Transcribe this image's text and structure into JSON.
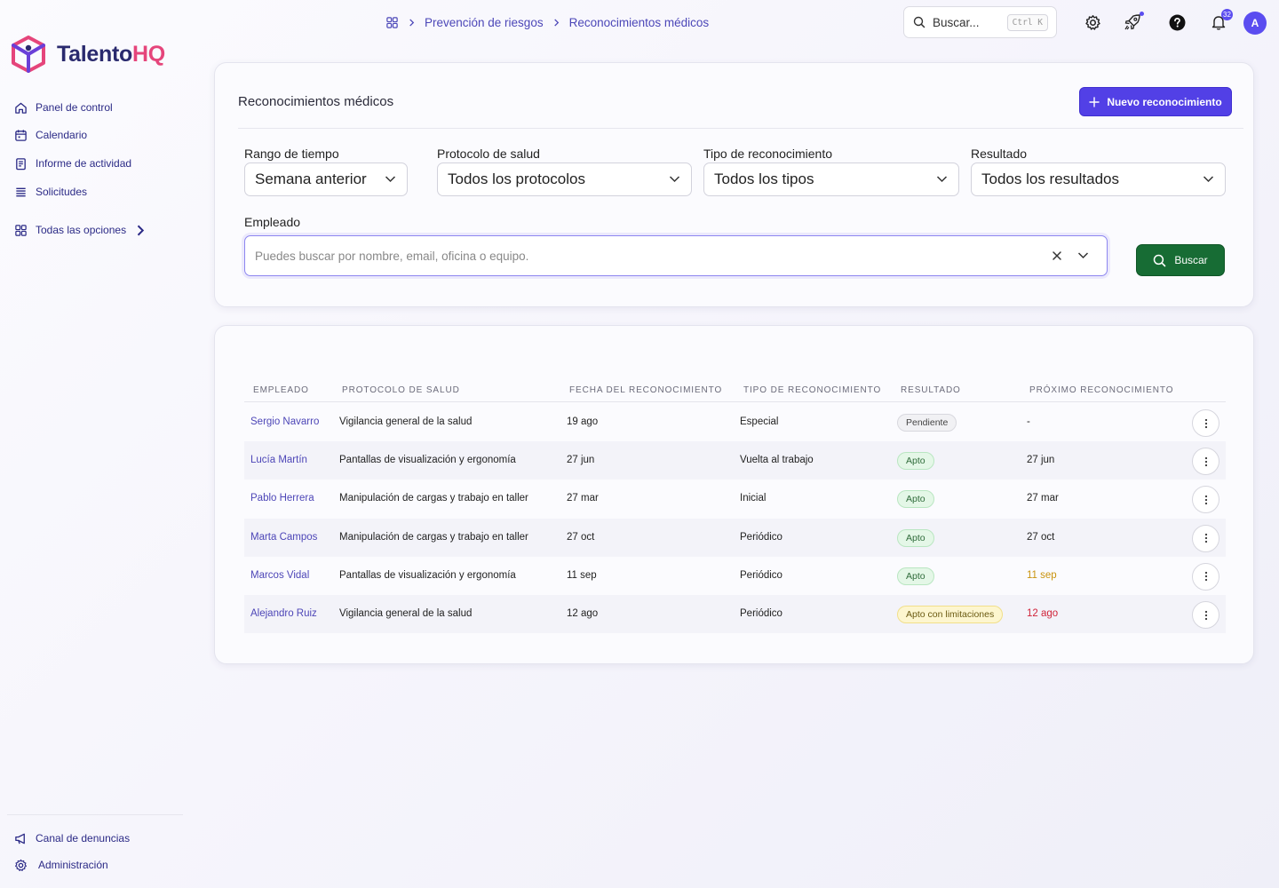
{
  "brand": {
    "name_part1": "Talento",
    "name_part2": "HQ",
    "color_primary": "#2a2a6e",
    "color_accent": "#e5457b"
  },
  "sidebar": {
    "items": [
      {
        "label": "Panel de control",
        "icon": "home-icon"
      },
      {
        "label": "Calendario",
        "icon": "calendar-icon"
      },
      {
        "label": "Informe de actividad",
        "icon": "report-icon"
      },
      {
        "label": "Solicitudes",
        "icon": "list-icon"
      }
    ],
    "all_options": {
      "label": "Todas las opciones",
      "icon": "grid-icon"
    },
    "bottom": [
      {
        "label": "Canal de denuncias",
        "icon": "megaphone-icon"
      },
      {
        "label": "Administración",
        "icon": "gear-icon"
      }
    ]
  },
  "topbar": {
    "breadcrumb": [
      "Prevención de riesgos",
      "Reconocimientos médicos"
    ],
    "search_label": "Buscar...",
    "search_shortcut": "Ctrl K",
    "notifications_count": "32",
    "avatar_initial": "A"
  },
  "filters": {
    "title": "Reconocimientos médicos",
    "new_button": "Nuevo reconocimiento",
    "time_range": {
      "label": "Rango de tiempo",
      "value": "Semana anterior"
    },
    "protocol": {
      "label": "Protocolo de salud",
      "value": "Todos los protocolos"
    },
    "type": {
      "label": "Tipo de reconocimiento",
      "value": "Todos los tipos"
    },
    "result": {
      "label": "Resultado",
      "value": "Todos los resultados"
    },
    "employee": {
      "label": "Empleado",
      "placeholder": "Puedes buscar por nombre, email, oficina o equipo."
    },
    "search_button": "Buscar"
  },
  "table": {
    "columns": [
      "EMPLEADO",
      "PROTOCOLO DE SALUD",
      "FECHA DEL RECONOCIMIENTO",
      "TIPO DE RECONOCIMIENTO",
      "RESULTADO",
      "PRÓXIMO RECONOCIMIENTO"
    ],
    "rows": [
      {
        "employee": "Sergio Navarro",
        "protocol": "Vigilancia general de la salud",
        "date": "19 ago",
        "type": "Especial",
        "result": "Pendiente",
        "result_status": "pending",
        "next": "-",
        "next_status": "normal"
      },
      {
        "employee": "Lucía Martín",
        "protocol": "Pantallas de visualización y ergonomía",
        "date": "27 jun",
        "type": "Vuelta al trabajo",
        "result": "Apto",
        "result_status": "ok",
        "next": "27 jun",
        "next_status": "normal"
      },
      {
        "employee": "Pablo Herrera",
        "protocol": "Manipulación de cargas y trabajo en taller",
        "date": "27 mar",
        "type": "Inicial",
        "result": "Apto",
        "result_status": "ok",
        "next": "27 mar",
        "next_status": "normal"
      },
      {
        "employee": "Marta Campos",
        "protocol": "Manipulación de cargas y trabajo en taller",
        "date": "27 oct",
        "type": "Periódico",
        "result": "Apto",
        "result_status": "ok",
        "next": "27 oct",
        "next_status": "normal"
      },
      {
        "employee": "Marcos Vidal",
        "protocol": "Pantallas de visualización y ergonomía",
        "date": "11 sep",
        "type": "Periódico",
        "result": "Apto",
        "result_status": "ok",
        "next": "11 sep",
        "next_status": "warning"
      },
      {
        "employee": "Alejandro Ruiz",
        "protocol": "Vigilancia general de la salud",
        "date": "12 ago",
        "type": "Periódico",
        "result": "Apto con limitaciones",
        "result_status": "limited",
        "next": "12 ago",
        "next_status": "overdue"
      }
    ]
  },
  "colors": {
    "pill_pending": {
      "bg": "#f1f1f4",
      "border": "#d8d8de",
      "text": "#444"
    },
    "pill_ok": {
      "bg": "#e4f7e7",
      "border": "#b9e6c1",
      "text": "#2f6b3a"
    },
    "pill_limited": {
      "bg": "#fdf6cf",
      "border": "#f1df8a",
      "text": "#6b5a12"
    },
    "next_normal": "#222222",
    "next_warning": "#c9930e",
    "next_overdue": "#d0243a"
  }
}
